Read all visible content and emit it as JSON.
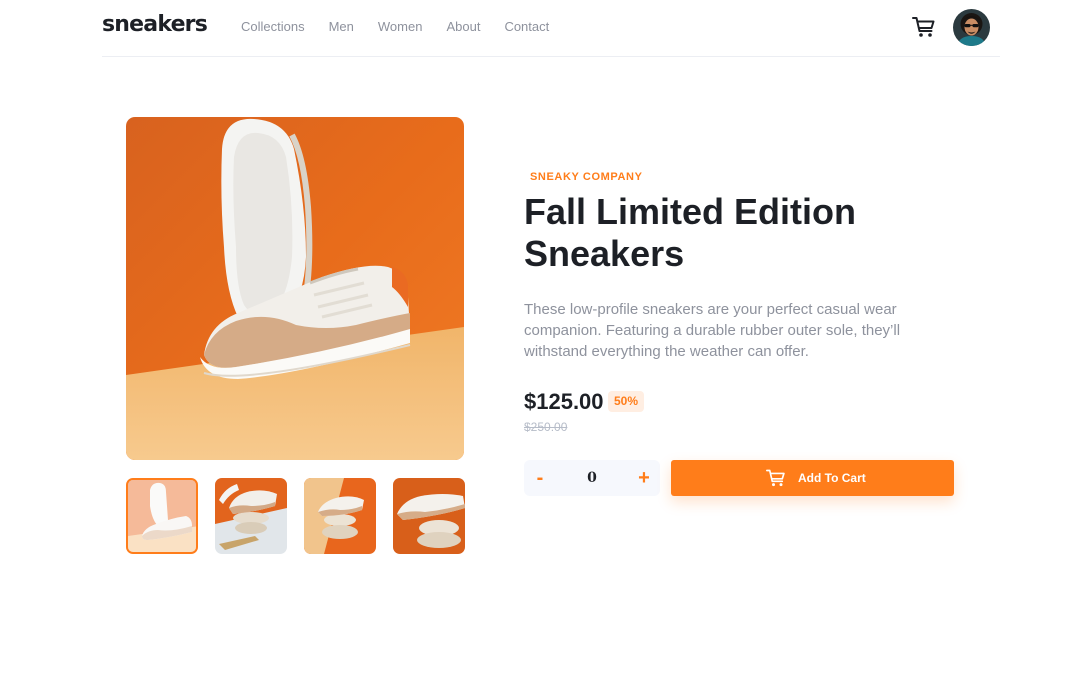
{
  "header": {
    "logo": "sneakers",
    "nav": [
      "Collections",
      "Men",
      "Women",
      "About",
      "Contact"
    ],
    "cart_icon": "cart-icon",
    "avatar_icon": "user-avatar"
  },
  "gallery": {
    "main_image": "sneaker-product-image",
    "thumbnails": [
      "thumbnail-1",
      "thumbnail-2",
      "thumbnail-3",
      "thumbnail-4"
    ],
    "active_thumbnail": 1
  },
  "product": {
    "company": "SNEAKY COMPANY",
    "title": "Fall Limited Edition Sneakers",
    "description": "These low-profile sneakers are your perfect casual wear companion. Featuring a durable rubber outer sole, they’ll withstand everything the weather can offer.",
    "price": "$125.00",
    "discount": "50%",
    "original_price": "$250.00"
  },
  "quantity": {
    "minus_label": "-",
    "value": "0",
    "plus_label": "+"
  },
  "add_to_cart": {
    "label": "Add To Cart",
    "icon": "cart-icon"
  },
  "colors": {
    "accent": "#ff7d1a",
    "accent_pale": "#ffeee2",
    "text_dark": "#1d2026",
    "text_muted": "#8e929d"
  }
}
